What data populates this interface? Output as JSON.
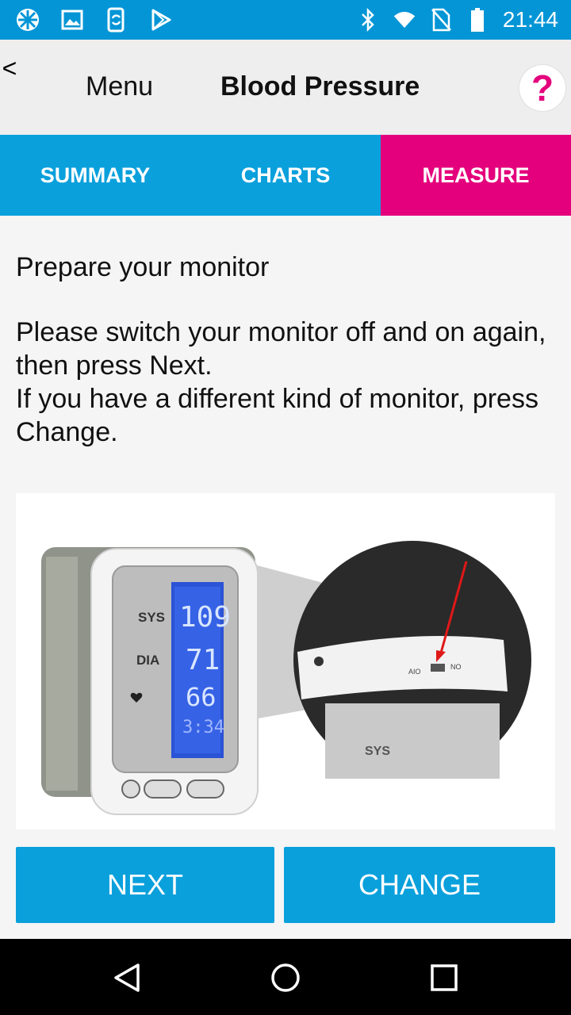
{
  "status_bar": {
    "time": "21:44",
    "left_icons": [
      "app-icon",
      "gallery-icon",
      "phone-sync-icon",
      "play-store-icon"
    ],
    "right_icons": [
      "bluetooth-icon",
      "wifi-icon",
      "no-sim-icon",
      "battery-icon"
    ]
  },
  "header": {
    "back_label": "<",
    "menu_label": "Menu",
    "title": "Blood Pressure",
    "help_label": "?"
  },
  "tabs": [
    {
      "label": "SUMMARY",
      "active": false
    },
    {
      "label": "CHARTS",
      "active": false
    },
    {
      "label": "MEASURE",
      "active": true
    }
  ],
  "main": {
    "heading": "Prepare your monitor",
    "instruction_lines": [
      "Please switch your monitor off and on again, then press Next.",
      "If you have a different kind of monitor, press Change."
    ],
    "illustration": {
      "display": {
        "sys_label": "SYS",
        "dia_label": "DIA",
        "sys_value": "109",
        "dia_value": "71",
        "pulse_value": "66",
        "time_value": "3:34"
      },
      "zoom_labels": {
        "sys_label": "SYS",
        "switch_left": "AIO",
        "switch_right": "NO"
      }
    }
  },
  "buttons": {
    "next_label": "NEXT",
    "change_label": "CHANGE"
  },
  "colors": {
    "primary_blue": "#0aa0dc",
    "status_blue": "#0395d6",
    "accent_pink": "#e4007c"
  },
  "nav_bar": {
    "icons": [
      "back-triangle-icon",
      "home-circle-icon",
      "recents-square-icon"
    ]
  }
}
